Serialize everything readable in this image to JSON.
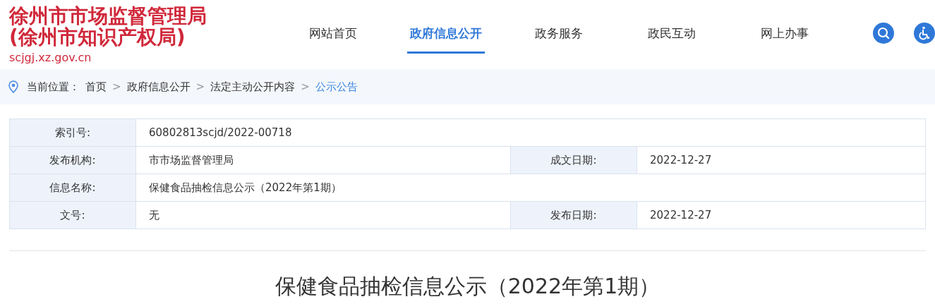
{
  "site": {
    "title_line_1": "徐州市市场监督管理局",
    "title_line_2": "(徐州市知识产权局)",
    "domain": "scjgj.xz.gov.cn"
  },
  "nav": [
    {
      "label": "网站首页",
      "selected": false
    },
    {
      "label": "政府信息公开",
      "selected": true
    },
    {
      "label": "政务服务",
      "selected": false
    },
    {
      "label": "政民互动",
      "selected": false
    },
    {
      "label": "网上办事",
      "selected": false
    }
  ],
  "breadcrumb": {
    "label": "当前位置：",
    "separator": ">",
    "items": [
      {
        "text": "首页",
        "selected": false
      },
      {
        "text": "政府信息公开",
        "selected": false
      },
      {
        "text": "法定主动公开内容",
        "selected": false
      },
      {
        "text": "公示公告",
        "selected": true
      }
    ]
  },
  "info_table": [
    {
      "cells": [
        {
          "kind": "label",
          "text": "索引号:"
        },
        {
          "kind": "value",
          "text": "60802813scjd/2022-00718"
        }
      ]
    },
    {
      "cells": [
        {
          "kind": "label",
          "text": "发布机构:"
        },
        {
          "kind": "value",
          "text": "市市场监督管理局"
        },
        {
          "kind": "label",
          "text": "成文日期:"
        },
        {
          "kind": "value",
          "text": "2022-12-27"
        }
      ]
    },
    {
      "cells": [
        {
          "kind": "label",
          "text": "信息名称:"
        },
        {
          "kind": "value",
          "text": "保健食品抽检信息公示（2022年第1期）"
        }
      ]
    },
    {
      "cells": [
        {
          "kind": "label",
          "text": "文号:"
        },
        {
          "kind": "value",
          "text": "无"
        },
        {
          "kind": "label",
          "text": "发布日期:"
        },
        {
          "kind": "value",
          "text": "2022-12-27"
        }
      ]
    }
  ],
  "article_title": "保健食品抽检信息公示（2022年第1期）"
}
